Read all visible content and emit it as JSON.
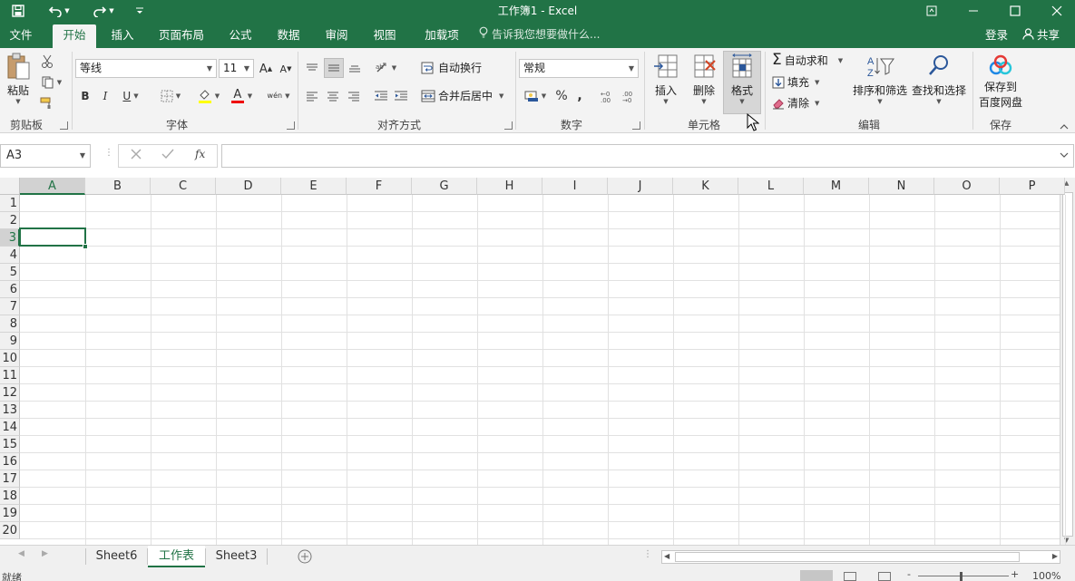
{
  "app": {
    "title": "工作簿1 - Excel"
  },
  "quick_access": {
    "save_icon": "save-icon",
    "undo_icon": "undo-icon",
    "redo_icon": "redo-icon",
    "customize_icon": "customize-icon"
  },
  "tabs": [
    {
      "label": "文件"
    },
    {
      "label": "开始"
    },
    {
      "label": "插入"
    },
    {
      "label": "页面布局"
    },
    {
      "label": "公式"
    },
    {
      "label": "数据"
    },
    {
      "label": "审阅"
    },
    {
      "label": "视图"
    },
    {
      "label": "加载项"
    }
  ],
  "tell_me": "告诉我您想要做什么...",
  "account": {
    "signin": "登录",
    "share": "共享"
  },
  "ribbon": {
    "clipboard": {
      "label": "剪贴板",
      "paste": "粘贴"
    },
    "font": {
      "label": "字体",
      "font_name": "等线",
      "font_size": "11",
      "bold": "B",
      "italic": "I",
      "underline": "U",
      "grow": "A",
      "shrink": "A",
      "color_a": "A",
      "wen": "wén"
    },
    "alignment": {
      "label": "对齐方式",
      "wrap": "自动换行",
      "merge": "合并后居中"
    },
    "number": {
      "label": "数字",
      "format": "常规",
      "percent": "%",
      "comma": ","
    },
    "cells": {
      "label": "单元格",
      "insert": "插入",
      "delete": "删除",
      "format": "格式"
    },
    "editing": {
      "label": "编辑",
      "autosum": "自动求和",
      "fill": "填充",
      "clear": "清除",
      "sort_filter": "排序和筛选",
      "find_select": "查找和选择"
    },
    "save": {
      "label": "保存",
      "baidu_line1": "保存到",
      "baidu_line2": "百度网盘"
    }
  },
  "formula_bar": {
    "name_box": "A3",
    "fx": "fx",
    "value": ""
  },
  "grid": {
    "columns": [
      "A",
      "B",
      "C",
      "D",
      "E",
      "F",
      "G",
      "H",
      "I",
      "J",
      "K",
      "L",
      "M",
      "N",
      "O",
      "P"
    ],
    "rows": [
      "1",
      "2",
      "3",
      "4",
      "5",
      "6",
      "7",
      "8",
      "9",
      "10",
      "11",
      "12",
      "13",
      "14",
      "15",
      "16",
      "17",
      "18",
      "19",
      "20"
    ],
    "selected_cell": "A3"
  },
  "sheets": [
    {
      "label": "Sheet6"
    },
    {
      "label": "工作表"
    },
    {
      "label": "Sheet3"
    }
  ],
  "status": {
    "ready": "就绪",
    "zoom": "100%"
  },
  "colors": {
    "brand": "#217346"
  }
}
